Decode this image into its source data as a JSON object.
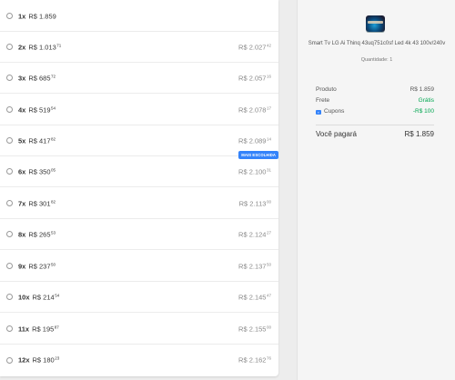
{
  "installments": [
    {
      "qty": "1x",
      "amount": "R$ 1.859",
      "amount_cents": "",
      "total": "",
      "total_cents": ""
    },
    {
      "qty": "2x",
      "amount": "R$ 1.013",
      "amount_cents": "71",
      "total": "R$ 2.027",
      "total_cents": "42"
    },
    {
      "qty": "3x",
      "amount": "R$ 685",
      "amount_cents": "72",
      "total": "R$ 2.057",
      "total_cents": "16"
    },
    {
      "qty": "4x",
      "amount": "R$ 519",
      "amount_cents": "54",
      "total": "R$ 2.078",
      "total_cents": "17"
    },
    {
      "qty": "5x",
      "amount": "R$ 417",
      "amount_cents": "82",
      "total": "R$ 2.089",
      "total_cents": "14"
    },
    {
      "qty": "6x",
      "amount": "R$ 350",
      "amount_cents": "05",
      "total": "R$ 2.100",
      "total_cents": "31",
      "badge": "MAIS ESCOLHIDA"
    },
    {
      "qty": "7x",
      "amount": "R$ 301",
      "amount_cents": "82",
      "total": "R$ 2.113",
      "total_cents": "00"
    },
    {
      "qty": "8x",
      "amount": "R$ 265",
      "amount_cents": "53",
      "total": "R$ 2.124",
      "total_cents": "27"
    },
    {
      "qty": "9x",
      "amount": "R$ 237",
      "amount_cents": "50",
      "total": "R$ 2.137",
      "total_cents": "50"
    },
    {
      "qty": "10x",
      "amount": "R$ 214",
      "amount_cents": "54",
      "total": "R$ 2.145",
      "total_cents": "47"
    },
    {
      "qty": "11x",
      "amount": "R$ 195",
      "amount_cents": "87",
      "total": "R$ 2.155",
      "total_cents": "00"
    },
    {
      "qty": "12x",
      "amount": "R$ 180",
      "amount_cents": "23",
      "total": "R$ 2.162",
      "total_cents": "76"
    }
  ],
  "summary": {
    "product_image_icon": "tv-image",
    "product_title": "Smart Tv LG Ai Thinq 43uq751c0sf Led 4k 43 100v/240v",
    "quantity": "Quantidade: 1",
    "product_label": "Produto",
    "product_value": "R$ 1.859",
    "shipping_label": "Frete",
    "shipping_value": "Grátis",
    "coupon_icon": "coupon-icon",
    "coupon_label": "Cupons",
    "coupon_value": "-R$ 100",
    "pay_label": "Você pagará",
    "pay_value": "R$ 1.859"
  },
  "colors": {
    "accent": "#3483fa",
    "green": "#00a650",
    "panel_bg": "#f5f5f5"
  }
}
